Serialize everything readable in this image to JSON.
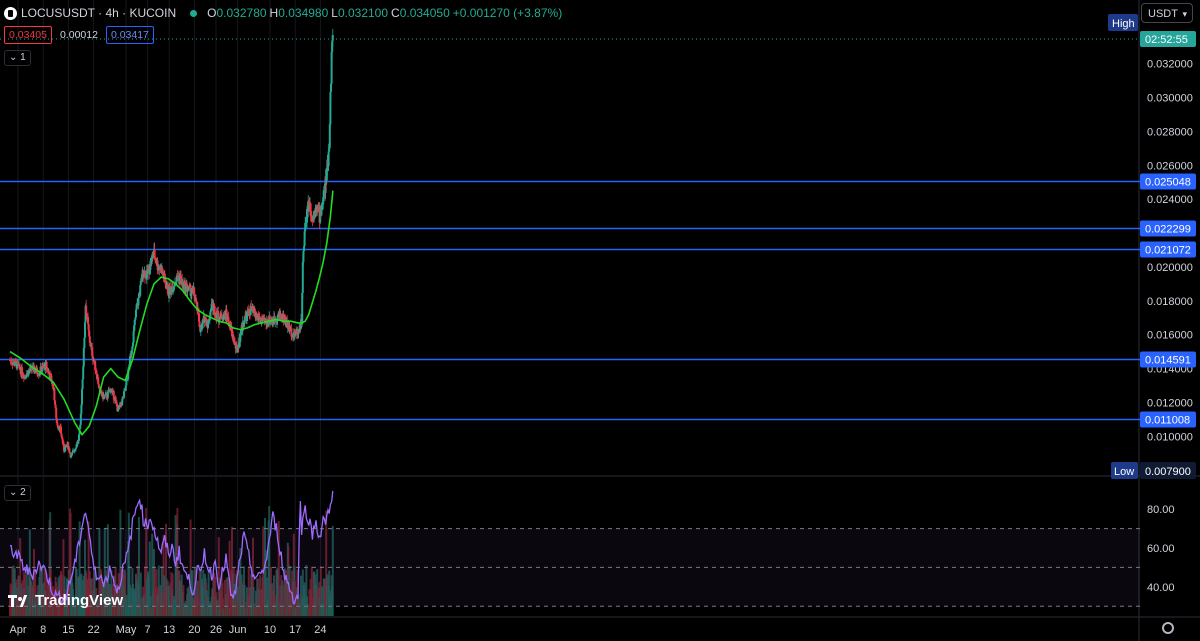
{
  "header": {
    "symbol_line": "LOCUSUSDT · 4h · KUCOIN",
    "open_label": "O",
    "open": "0.032780",
    "high_label": "H",
    "high": "0.034980",
    "low_label": "L",
    "low": "0.032100",
    "close_label": "C",
    "close": "0.034050",
    "change": "+0.001270 (+3.87%)"
  },
  "trade": {
    "sell_price": "0.03405",
    "spread": "0.00012",
    "buy_price": "0.03417"
  },
  "currency_selector": "USDT",
  "pane_tags": {
    "main": "1",
    "indicator": "2"
  },
  "watermark": "TradingView",
  "colors": {
    "up": "#22ab94",
    "down": "#f23645",
    "ma": "#22dd22",
    "rsi": "#9b6cff",
    "level_line": "#2962ff",
    "price_tag": "#26a69a"
  },
  "chart_data": [
    {
      "type": "candlestick",
      "x_ticks": [
        "Apr",
        "8",
        "15",
        "22",
        "May",
        "7",
        "13",
        "20",
        "26",
        "Jun",
        "10",
        "17",
        "24"
      ],
      "y_ticks": [
        "0.032000",
        "0.030000",
        "0.028000",
        "0.026000",
        "0.024000",
        "0.020000",
        "0.018000",
        "0.016000",
        "0.014000",
        "0.012000",
        "0.010000"
      ],
      "ylim": [
        0.0069,
        0.0341
      ],
      "last_price": "0.034050",
      "countdown": "02:52:55",
      "high_label": "High",
      "low_label": "Low",
      "low_value": "0.007900",
      "horizontal_levels": [
        "0.025048",
        "0.022299",
        "0.021072",
        "0.014591",
        "0.011008"
      ],
      "series": [
        {
          "name": "",
          "style": "moving-average line"
        }
      ],
      "path_days": [
        0,
        2,
        4,
        6,
        8,
        10,
        12,
        13,
        14,
        15,
        16,
        17,
        18,
        19,
        19.5,
        20,
        20.5,
        21,
        22,
        23,
        24,
        25,
        26,
        27,
        28,
        29,
        30,
        31,
        32,
        33,
        34,
        35,
        36,
        37,
        38,
        39,
        40,
        41,
        42,
        43,
        44,
        45,
        46,
        47,
        48,
        49,
        50,
        51,
        52,
        53,
        54,
        55,
        56,
        57,
        58,
        59,
        60,
        61,
        62,
        63,
        64,
        65,
        66,
        67,
        68,
        69,
        70,
        71,
        72,
        73,
        74,
        75,
        76,
        77,
        78,
        79,
        80,
        81,
        81.3,
        82,
        83,
        84,
        85,
        86,
        87,
        88,
        88.6,
        89,
        89.4,
        89.7
      ],
      "path_prices": [
        0.0145,
        0.0142,
        0.0136,
        0.014,
        0.0138,
        0.0142,
        0.013,
        0.0108,
        0.0104,
        0.0092,
        0.0095,
        0.0088,
        0.0093,
        0.0098,
        0.0105,
        0.0128,
        0.015,
        0.0178,
        0.0158,
        0.0147,
        0.0138,
        0.0126,
        0.0123,
        0.0124,
        0.0128,
        0.0123,
        0.0115,
        0.012,
        0.0127,
        0.014,
        0.0155,
        0.0173,
        0.0185,
        0.0198,
        0.0195,
        0.0202,
        0.0208,
        0.0201,
        0.0199,
        0.0192,
        0.0185,
        0.0188,
        0.0192,
        0.0195,
        0.0189,
        0.0188,
        0.0186,
        0.0185,
        0.0175,
        0.0162,
        0.017,
        0.0166,
        0.0178,
        0.0174,
        0.017,
        0.0171,
        0.0172,
        0.0166,
        0.0158,
        0.015,
        0.016,
        0.0169,
        0.0172,
        0.0175,
        0.0172,
        0.017,
        0.0168,
        0.0167,
        0.0169,
        0.0168,
        0.017,
        0.0172,
        0.017,
        0.0166,
        0.0162,
        0.016,
        0.0162,
        0.0168,
        0.02,
        0.0225,
        0.024,
        0.0228,
        0.0238,
        0.023,
        0.024,
        0.0255,
        0.027,
        0.03,
        0.033,
        0.034
      ],
      "ma_days": [
        0,
        3,
        6,
        9,
        12,
        15,
        18,
        20,
        22,
        24,
        26,
        28,
        30,
        32,
        34,
        36,
        38,
        40,
        42,
        44,
        46,
        48,
        50,
        52,
        54,
        56,
        58,
        60,
        62,
        64,
        66,
        68,
        70,
        72,
        74,
        76,
        78,
        80,
        81,
        82,
        83,
        84,
        85,
        86,
        87,
        88,
        89,
        89.7
      ],
      "ma_values": [
        0.015,
        0.0146,
        0.0141,
        0.0137,
        0.0132,
        0.0122,
        0.0108,
        0.0101,
        0.0106,
        0.0118,
        0.0135,
        0.014,
        0.0135,
        0.0133,
        0.0145,
        0.0162,
        0.0178,
        0.019,
        0.0194,
        0.0193,
        0.019,
        0.0186,
        0.018,
        0.0175,
        0.0172,
        0.017,
        0.0168,
        0.0167,
        0.0164,
        0.0163,
        0.0164,
        0.0166,
        0.0167,
        0.0168,
        0.0169,
        0.0168,
        0.0168,
        0.0167,
        0.0167,
        0.0168,
        0.0172,
        0.0179,
        0.0186,
        0.0194,
        0.0203,
        0.0214,
        0.023,
        0.0245
      ]
    },
    {
      "type": "line",
      "name": "",
      "y_ticks": [
        "80.00",
        "60.00",
        "40.00"
      ],
      "ylim": [
        25,
        95
      ],
      "bands": [
        70,
        50,
        30
      ],
      "x": [
        0,
        2,
        4,
        6,
        8,
        10,
        11,
        12,
        13,
        14,
        15,
        16,
        17,
        18,
        19,
        20,
        21,
        22,
        23,
        24,
        25,
        26,
        27,
        28,
        29,
        30,
        31,
        32,
        33,
        34,
        35,
        36,
        37,
        38,
        39,
        40,
        41,
        42,
        43,
        44,
        45,
        46,
        47,
        48,
        49,
        50,
        51,
        52,
        53,
        54,
        55,
        56,
        57,
        58,
        59,
        60,
        61,
        62,
        63,
        64,
        65,
        66,
        67,
        68,
        69,
        70,
        71,
        72,
        73,
        74,
        75,
        76,
        77,
        78,
        79,
        80,
        80.6,
        81,
        82,
        83,
        84,
        85,
        86,
        87,
        88,
        89,
        89.7
      ],
      "values": [
        60,
        56,
        50,
        46,
        52,
        48,
        42,
        38,
        34,
        36,
        33,
        38,
        45,
        52,
        60,
        72,
        79,
        68,
        52,
        45,
        48,
        40,
        46,
        50,
        42,
        38,
        47,
        52,
        60,
        72,
        80,
        87,
        75,
        71,
        76,
        70,
        63,
        58,
        64,
        57,
        60,
        53,
        58,
        50,
        46,
        42,
        38,
        50,
        45,
        58,
        50,
        46,
        53,
        42,
        47,
        55,
        40,
        32,
        42,
        56,
        66,
        58,
        50,
        45,
        44,
        48,
        52,
        64,
        76,
        70,
        60,
        47,
        43,
        38,
        33,
        35,
        88,
        70,
        80,
        75,
        67,
        74,
        65,
        73,
        75,
        82,
        92
      ]
    }
  ]
}
